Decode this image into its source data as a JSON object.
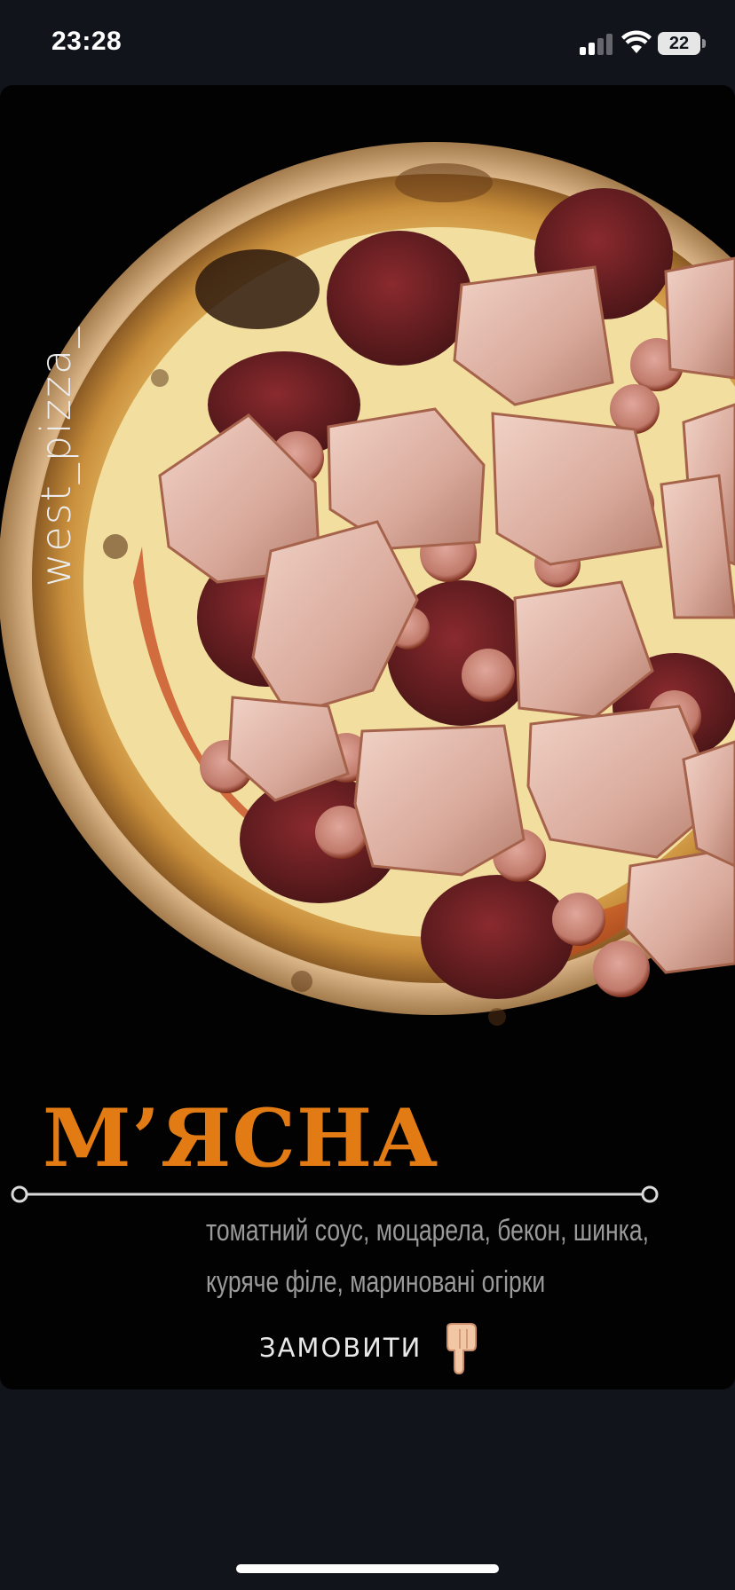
{
  "status_bar": {
    "time": "23:28",
    "battery_level": "22",
    "icons": [
      "signal-icon",
      "wifi-icon",
      "battery-icon"
    ]
  },
  "story": {
    "brand_handle": "west_pizza_",
    "pizza_name": "М’ЯСНА",
    "ingredients_lines": [
      "томатний соус, моцарела, бекон, шинка,",
      "куряче філе, мариновані огірки"
    ],
    "order_label": "ЗАМОВИТИ",
    "order_icon": "pointing-down-hand-icon"
  },
  "colors": {
    "background": "#12141c",
    "card": "#020202",
    "accent": "#e27b13",
    "ingredients_text": "#9a9a9a"
  }
}
